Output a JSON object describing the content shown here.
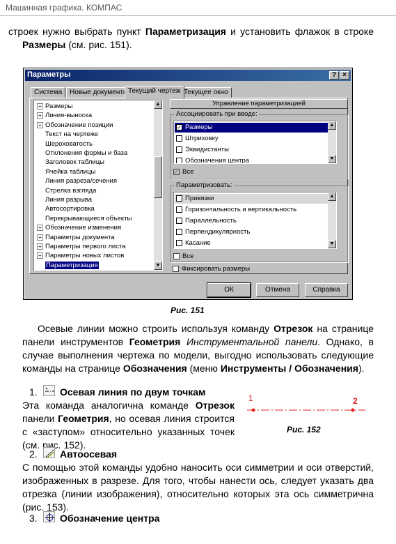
{
  "header": {
    "running_title": "Машинная графика. КОМПАС"
  },
  "intro": {
    "t1": "строек нужно выбрать пункт ",
    "b1": "Параметризация",
    "t2": " и установить флажок в строке ",
    "b2": "Размеры",
    "t3": " (см. рис. 151)."
  },
  "dialog": {
    "title": "Параметры",
    "title_buttons": [
      "?",
      "×"
    ],
    "tabs": [
      "Система",
      "Новые документы",
      "Текущий чертеж",
      "Текущее окно"
    ],
    "active_tab": "Текущий чертеж",
    "tree": [
      {
        "label": "Размеры",
        "expandable": true
      },
      {
        "label": "Линия-выноска",
        "expandable": true
      },
      {
        "label": "Обозначение позиции",
        "expandable": true
      },
      {
        "label": "Текст на чертеже",
        "expandable": false
      },
      {
        "label": "Шероховатость",
        "expandable": false
      },
      {
        "label": "Отклонения формы и база",
        "expandable": false
      },
      {
        "label": "Заголовок таблицы",
        "expandable": false
      },
      {
        "label": "Ячейка таблицы",
        "expandable": false
      },
      {
        "label": "Линия разреза/сечения",
        "expandable": false
      },
      {
        "label": "Стрелка взгляда",
        "expandable": false
      },
      {
        "label": "Линия разрыва",
        "expandable": false
      },
      {
        "label": "Автосортировка",
        "expandable": false
      },
      {
        "label": "Перекрывающиеся объекты",
        "expandable": false
      },
      {
        "label": "Обозначение изменения",
        "expandable": true
      },
      {
        "label": "Параметры документа",
        "expandable": true
      },
      {
        "label": "Параметры первого листа",
        "expandable": true
      },
      {
        "label": "Параметры новых листов",
        "expandable": true
      },
      {
        "label": "Параметризация",
        "expandable": false,
        "selected": true
      }
    ],
    "right_header": "Управление параметризацией",
    "associate_group": {
      "label": "Ассоциировать при вводе:",
      "items": [
        {
          "label": "Размеры",
          "checked": true,
          "selected": true
        },
        {
          "label": "Штриховку",
          "checked": false
        },
        {
          "label": "Эквидистанты",
          "checked": false
        },
        {
          "label": "Обозначения центра",
          "checked": false
        }
      ],
      "all_label": "Все",
      "all_checked": true
    },
    "parametrize_group": {
      "label": "Параметризовать:",
      "items": [
        {
          "label": "Привязки",
          "checked": false,
          "highlight": true
        },
        {
          "label": "Горизонтальность и вертикальность",
          "checked": false
        },
        {
          "label": "Параллельность",
          "checked": false
        },
        {
          "label": "Перпендикулярность",
          "checked": false
        },
        {
          "label": "Касание",
          "checked": false
        }
      ],
      "all_label": "Все",
      "all_checked": false
    },
    "fix_dims_label": "Фиксировать размеры",
    "buttons": {
      "ok": "ОК",
      "cancel": "Отмена",
      "help": "Справка"
    },
    "checkmark": "✓"
  },
  "fig151_caption": "Рис. 151",
  "para2": {
    "t1": "Осевые линии можно строить используя команду ",
    "b1": "Отрезок",
    "t2": " на странице панели инструментов ",
    "b2": "Геометрия",
    "t3": " ",
    "i1": "Инструментальной панели",
    "t4": ". Однако, в случае выполнения чертежа по модели, выгодно использовать следующие команды на странице ",
    "b3": "Обозначения",
    "t5": " (меню ",
    "b4": "Инструменты / Обозначения",
    "t6": ")."
  },
  "items": [
    {
      "num": "1.",
      "title": "Осевая линия по двум точкам",
      "icon": "axis-line-two-points-icon"
    },
    {
      "num": "2.",
      "title": "Автоосевая",
      "icon": "auto-axis-icon"
    },
    {
      "num": "3.",
      "title": "Обозначение центра",
      "icon": "center-mark-icon"
    }
  ],
  "item1_text": {
    "t1": "Эта команда аналогична команде ",
    "b1": "Отрезок",
    "t2": " панели ",
    "b2": "Геометрия",
    "t3": ", но осевая линия строится с «заступом» относительно указанных точек (см. рис. 152)."
  },
  "fig152": {
    "point1": "1",
    "point2": "2",
    "caption": "Рис. 152",
    "accent": "#e02020"
  },
  "item2_text": "С помощью этой команды удобно наносить оси симметрии и оси отверстий, изображенных в разрезе. Для того, чтобы нанести ось, следует указать два отрезка (линии изображения), относительно которых эта ось симметрична (рис. 153)."
}
